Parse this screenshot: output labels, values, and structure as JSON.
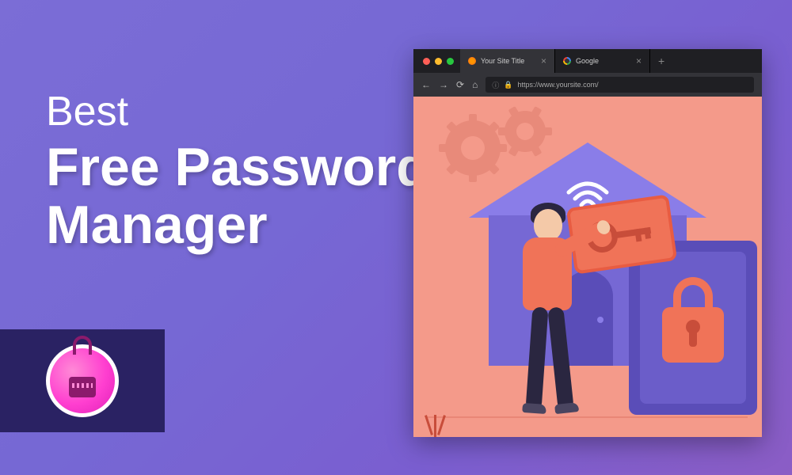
{
  "headline": {
    "line1": "Best",
    "line2": "Free Password",
    "line3": "Manager"
  },
  "browser": {
    "tabs": [
      {
        "label": "Your Site Title",
        "active": true
      },
      {
        "label": "Google",
        "active": false
      }
    ],
    "url": "https://www.yoursite.com/"
  }
}
